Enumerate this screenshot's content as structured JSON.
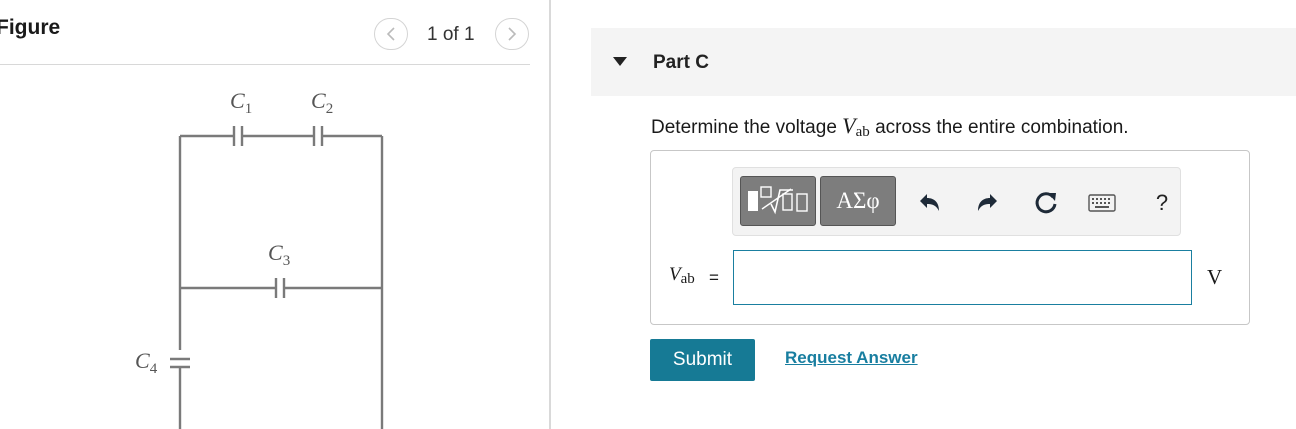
{
  "figure": {
    "title": "Figure",
    "page_indicator": "1 of 1",
    "prev_icon": "chevron-left-icon",
    "next_icon": "chevron-right-icon",
    "circuit_labels": {
      "c1": "C1",
      "c2": "C2",
      "c3": "C3",
      "c4": "C4"
    }
  },
  "question": {
    "part_label": "Part C",
    "text_before": "Determine the voltage ",
    "var_main": "V",
    "var_sub": "ab",
    "text_after": " across the entire combination.",
    "toolbar": {
      "templates_icon": "templates-icon",
      "symbols_label": "ΑΣφ",
      "undo_icon": "undo-icon",
      "redo_icon": "redo-icon",
      "reset_icon": "reset-icon",
      "keyboard_icon": "keyboard-icon",
      "help_label": "?"
    },
    "answer_var_main": "V",
    "answer_var_sub": "ab",
    "equals": "=",
    "input_value": "",
    "unit": "V",
    "submit_label": "Submit",
    "request_answer_label": "Request Answer"
  },
  "colors": {
    "accent": "#167a95",
    "link": "#187ea0",
    "header_bg": "#f4f4f4",
    "toolbar_button": "#7d7d7d"
  }
}
